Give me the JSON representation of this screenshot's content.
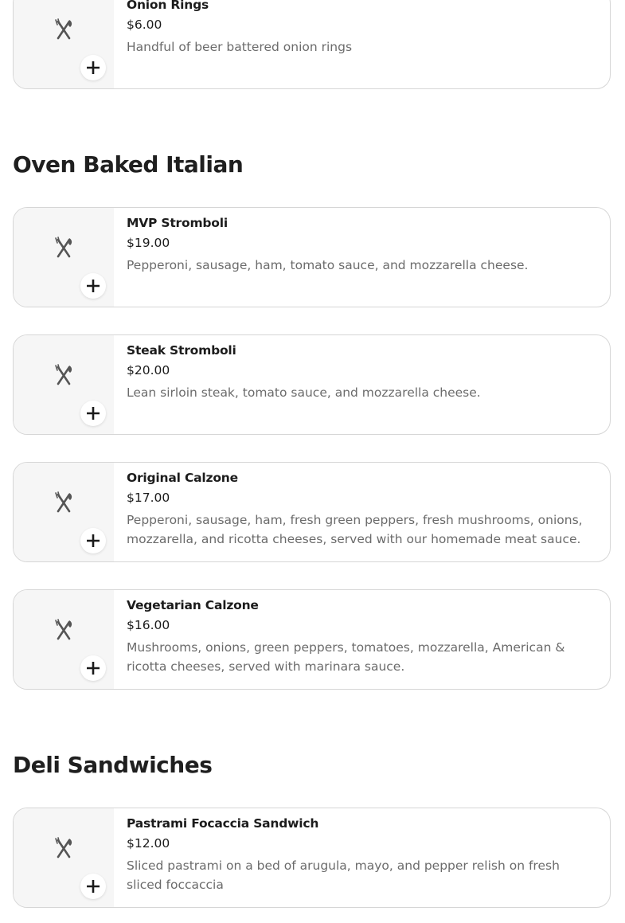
{
  "sections": [
    {
      "title": "",
      "items": [
        {
          "name": "Onion Rings",
          "price": "$6.00",
          "description": "Handful of beer battered onion rings"
        }
      ]
    },
    {
      "title": "Oven Baked Italian",
      "items": [
        {
          "name": "MVP Stromboli",
          "price": "$19.00",
          "description": "Pepperoni, sausage, ham, tomato sauce, and mozzarella cheese."
        },
        {
          "name": "Steak Stromboli",
          "price": "$20.00",
          "description": "Lean sirloin steak, tomato sauce, and mozzarella cheese."
        },
        {
          "name": "Original Calzone",
          "price": "$17.00",
          "description": "Pepperoni, sausage, ham, fresh green peppers, fresh mushrooms, onions, mozzarella, and ricotta cheeses, served with our homemade meat sauce."
        },
        {
          "name": "Vegetarian Calzone",
          "price": "$16.00",
          "description": "Mushrooms, onions, green peppers, tomatoes, mozzarella, American & ricotta cheeses, served with marinara sauce."
        }
      ]
    },
    {
      "title": "Deli Sandwiches",
      "items": [
        {
          "name": "Pastrami Focaccia Sandwich",
          "price": "$12.00",
          "description": "Sliced pastrami on a bed of arugula, mayo, and pepper relish on fresh sliced foccaccia"
        }
      ]
    }
  ],
  "icons": {
    "placeholder": "utensils-icon",
    "add": "plus-icon"
  }
}
